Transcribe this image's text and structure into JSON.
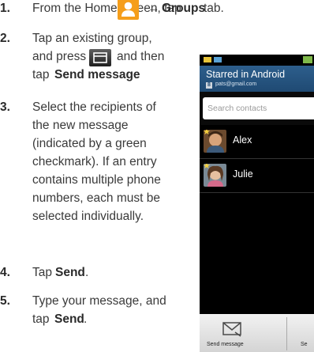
{
  "steps": [
    {
      "num": "1.",
      "pre": "From the Home screen, tap",
      "arrow": "→",
      "bold": "Groups",
      "post": "tab."
    },
    {
      "num": "2.",
      "l1": "Tap an existing group,",
      "l2a": "and press",
      "l2b": "and then",
      "l3a": "tap",
      "l3b": "Send message",
      "l3c": "."
    },
    {
      "num": "3.",
      "lines": [
        "Select the recipients of",
        "the new message",
        "(indicated by a green",
        "checkmark). If an entry",
        "contains multiple phone",
        "numbers, each must be",
        "selected individually."
      ]
    },
    {
      "num": "4.",
      "pre": "Tap",
      "bold": "Send",
      "post": "."
    },
    {
      "num": "5.",
      "l1": "Type your message, and",
      "l2a": "tap",
      "l2b": "Send",
      "l2c": "."
    }
  ],
  "icons": {
    "contacts": "contacts-app-icon",
    "menu": "menu-key-icon",
    "send_message": "send-message-icon"
  },
  "phone": {
    "title": "Starred in Android",
    "account_badge": "8",
    "account": "pats@gmail.com",
    "search_placeholder": "Search contacts",
    "contacts": [
      {
        "name": "Alex"
      },
      {
        "name": "Julie"
      }
    ],
    "bottom_actions": [
      "Send message",
      "Se"
    ]
  },
  "colors": {
    "contacts_icon": "#f59e1b",
    "title_bar": "#1f4a73",
    "star": "#f4d03f"
  }
}
